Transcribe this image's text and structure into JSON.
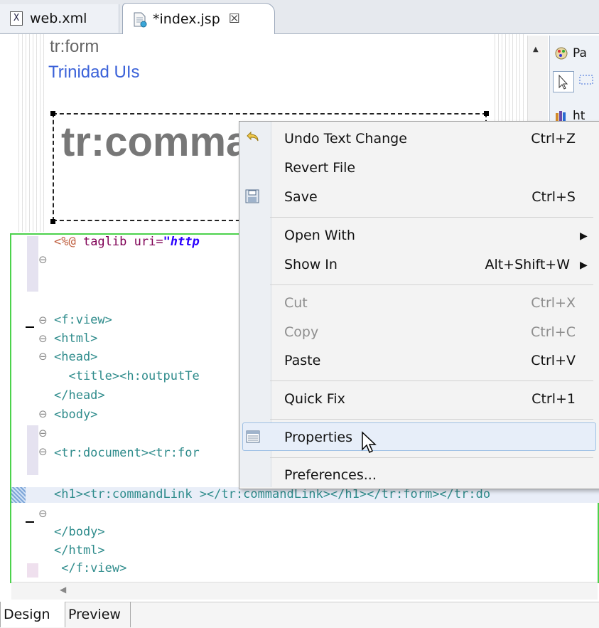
{
  "tabs": [
    {
      "label": "web.xml",
      "icon": "xml-file-icon"
    },
    {
      "label": "*index.jsp",
      "icon": "jsp-file-icon",
      "close": "☒"
    }
  ],
  "design": {
    "form_label": "tr:form",
    "library_label": "Trinidad UIs",
    "command_text": "tr:comma"
  },
  "palette": {
    "items": [
      "Pa",
      "ht"
    ]
  },
  "source": {
    "lines": [
      "<%@ taglib uri=\"http",
      "<f:view>",
      "<html>",
      "<head>",
      "  <title><h:outputTe",
      "</head>",
      "<body>",
      "<tr:document><tr:for",
      "<h1><tr:commandLink ></tr:commandLink></h1></tr:form></tr:do",
      "</body>",
      "</html>",
      " </f:view>"
    ],
    "taglib_prefix": "<%@ ",
    "taglib_name": "taglib ",
    "taglib_attr": "uri=",
    "taglib_str": "\"http"
  },
  "context_menu": {
    "items": [
      {
        "label": "Undo Text Change",
        "accel": "Ctrl+Z",
        "icon": "undo-icon"
      },
      {
        "label": "Revert File",
        "accel": ""
      },
      {
        "label": "Save",
        "accel": "Ctrl+S",
        "icon": "save-icon"
      },
      {
        "label": "Open With",
        "accel": "",
        "submenu": "▶"
      },
      {
        "label": "Show In",
        "accel": "Alt+Shift+W",
        "submenu": "▶"
      },
      {
        "label": "Cut",
        "accel": "Ctrl+X"
      },
      {
        "label": "Copy",
        "accel": "Ctrl+C"
      },
      {
        "label": "Paste",
        "accel": "Ctrl+V"
      },
      {
        "label": "Quick Fix",
        "accel": "Ctrl+1"
      },
      {
        "label": "Properties",
        "accel": "",
        "icon": "properties-icon"
      },
      {
        "label": "Preferences...",
        "accel": ""
      }
    ]
  },
  "bottom_tabs": [
    "Design",
    "Preview"
  ]
}
